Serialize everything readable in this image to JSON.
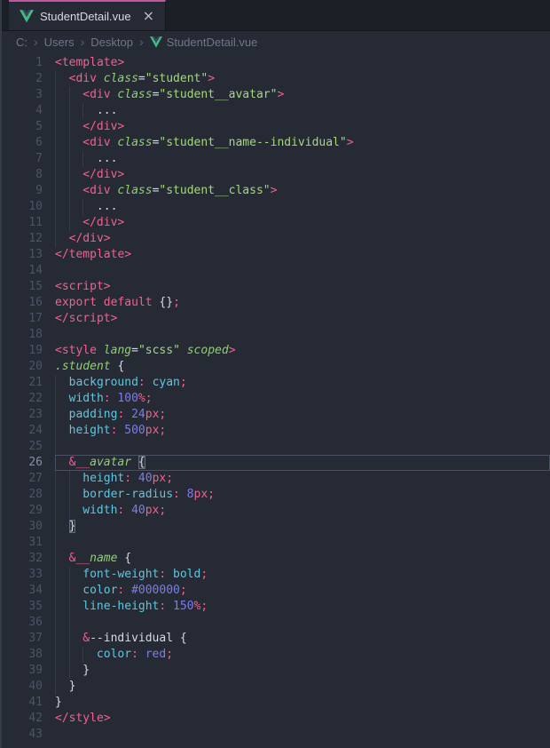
{
  "theme": {
    "bg": "#262a34",
    "tab_bar": "#1b2027",
    "accent": "#c0589e",
    "pink": "#f1618f",
    "green": "#8ed16e",
    "string": "#a3d97c",
    "cyan": "#5cc8e2",
    "violet": "#7d7ce8",
    "fg": "#d6dae4",
    "line_number": "#4c5366",
    "line_number_active": "#8590a8",
    "guide": "#353b4a",
    "line_highlight": "#485064",
    "bracket": "#606a80",
    "breadcrumb": "#6d7689",
    "vue_green": "#42b883",
    "vue_dark": "#35495e"
  },
  "tab": {
    "title": "StudentDetail.vue",
    "close_glyph": "×"
  },
  "breadcrumb": {
    "separator": "›",
    "items": [
      "C:",
      "Users",
      "Desktop",
      "StudentDetail.vue"
    ]
  },
  "editor": {
    "current_line": 26,
    "lines": [
      {
        "n": 1,
        "g": 0,
        "t": [
          [
            "p",
            "<template>"
          ]
        ]
      },
      {
        "n": 2,
        "g": 1,
        "t": [
          [
            "p",
            "<div "
          ],
          [
            "g",
            "class"
          ],
          [
            "w",
            "="
          ],
          [
            "s",
            "\"student\""
          ],
          [
            "p",
            ">"
          ]
        ]
      },
      {
        "n": 3,
        "g": 2,
        "t": [
          [
            "p",
            "<div "
          ],
          [
            "g",
            "class"
          ],
          [
            "w",
            "="
          ],
          [
            "s",
            "\"student__avatar\""
          ],
          [
            "p",
            ">"
          ]
        ]
      },
      {
        "n": 4,
        "g": 3,
        "t": [
          [
            "w",
            "..."
          ]
        ]
      },
      {
        "n": 5,
        "g": 2,
        "t": [
          [
            "p",
            "</div>"
          ]
        ]
      },
      {
        "n": 6,
        "g": 2,
        "t": [
          [
            "p",
            "<div "
          ],
          [
            "g",
            "class"
          ],
          [
            "w",
            "="
          ],
          [
            "s",
            "\"student__name--individual\""
          ],
          [
            "p",
            ">"
          ]
        ]
      },
      {
        "n": 7,
        "g": 3,
        "t": [
          [
            "w",
            "..."
          ]
        ]
      },
      {
        "n": 8,
        "g": 2,
        "t": [
          [
            "p",
            "</div>"
          ]
        ]
      },
      {
        "n": 9,
        "g": 2,
        "t": [
          [
            "p",
            "<div "
          ],
          [
            "g",
            "class"
          ],
          [
            "w",
            "="
          ],
          [
            "s",
            "\"student__class\""
          ],
          [
            "p",
            ">"
          ]
        ]
      },
      {
        "n": 10,
        "g": 3,
        "t": [
          [
            "w",
            "..."
          ]
        ]
      },
      {
        "n": 11,
        "g": 2,
        "t": [
          [
            "p",
            "</div>"
          ]
        ]
      },
      {
        "n": 12,
        "g": 1,
        "t": [
          [
            "p",
            "</div>"
          ]
        ]
      },
      {
        "n": 13,
        "g": 0,
        "t": [
          [
            "p",
            "</template>"
          ]
        ]
      },
      {
        "n": 14,
        "g": 0,
        "t": []
      },
      {
        "n": 15,
        "g": 0,
        "t": [
          [
            "p",
            "<script>"
          ]
        ]
      },
      {
        "n": 16,
        "g": 0,
        "t": [
          [
            "p",
            "export default "
          ],
          [
            "w",
            "{}"
          ],
          [
            "p",
            ";"
          ]
        ]
      },
      {
        "n": 17,
        "g": 0,
        "t": [
          [
            "p",
            "</script>"
          ]
        ]
      },
      {
        "n": 18,
        "g": 0,
        "t": []
      },
      {
        "n": 19,
        "g": 0,
        "t": [
          [
            "p",
            "<style "
          ],
          [
            "g",
            "lang"
          ],
          [
            "w",
            "="
          ],
          [
            "s",
            "\"scss\""
          ],
          [
            "g",
            " scoped"
          ],
          [
            "p",
            ">"
          ]
        ]
      },
      {
        "n": 20,
        "g": 0,
        "t": [
          [
            "g",
            ".student"
          ],
          [
            "w",
            " {"
          ]
        ]
      },
      {
        "n": 21,
        "g": 1,
        "t": [
          [
            "c",
            "background"
          ],
          [
            "p",
            ":"
          ],
          [
            "c",
            " cyan"
          ],
          [
            "p",
            ";"
          ]
        ]
      },
      {
        "n": 22,
        "g": 1,
        "t": [
          [
            "c",
            "width"
          ],
          [
            "p",
            ":"
          ],
          [
            "v",
            " 100"
          ],
          [
            "p",
            "%;"
          ]
        ]
      },
      {
        "n": 23,
        "g": 1,
        "t": [
          [
            "c",
            "padding"
          ],
          [
            "p",
            ":"
          ],
          [
            "v",
            " 24"
          ],
          [
            "p",
            "px;"
          ]
        ]
      },
      {
        "n": 24,
        "g": 1,
        "t": [
          [
            "c",
            "height"
          ],
          [
            "p",
            ":"
          ],
          [
            "v",
            " 500"
          ],
          [
            "p",
            "px;"
          ]
        ]
      },
      {
        "n": 25,
        "g": 1,
        "t": []
      },
      {
        "n": 26,
        "g": 1,
        "t": [
          [
            "p",
            "&__"
          ],
          [
            "g",
            "avatar"
          ],
          [
            "w",
            " "
          ],
          [
            "b",
            "{"
          ]
        ]
      },
      {
        "n": 27,
        "g": 2,
        "t": [
          [
            "c",
            "height"
          ],
          [
            "p",
            ":"
          ],
          [
            "v",
            " 40"
          ],
          [
            "p",
            "px;"
          ]
        ]
      },
      {
        "n": 28,
        "g": 2,
        "t": [
          [
            "c",
            "border-radius"
          ],
          [
            "p",
            ":"
          ],
          [
            "v",
            " 8"
          ],
          [
            "p",
            "px;"
          ]
        ]
      },
      {
        "n": 29,
        "g": 2,
        "t": [
          [
            "c",
            "width"
          ],
          [
            "p",
            ":"
          ],
          [
            "v",
            " 40"
          ],
          [
            "p",
            "px;"
          ]
        ]
      },
      {
        "n": 30,
        "g": 1,
        "t": [
          [
            "b",
            "}"
          ]
        ]
      },
      {
        "n": 31,
        "g": 1,
        "t": []
      },
      {
        "n": 32,
        "g": 1,
        "t": [
          [
            "p",
            "&__"
          ],
          [
            "g",
            "name"
          ],
          [
            "w",
            " {"
          ]
        ]
      },
      {
        "n": 33,
        "g": 2,
        "t": [
          [
            "c",
            "font-weight"
          ],
          [
            "p",
            ":"
          ],
          [
            "c",
            " bold"
          ],
          [
            "p",
            ";"
          ]
        ]
      },
      {
        "n": 34,
        "g": 2,
        "t": [
          [
            "c",
            "color"
          ],
          [
            "p",
            ":"
          ],
          [
            "v",
            " #000000"
          ],
          [
            "p",
            ";"
          ]
        ]
      },
      {
        "n": 35,
        "g": 2,
        "t": [
          [
            "c",
            "line-height"
          ],
          [
            "p",
            ":"
          ],
          [
            "v",
            " 150"
          ],
          [
            "p",
            "%;"
          ]
        ]
      },
      {
        "n": 36,
        "g": 2,
        "t": []
      },
      {
        "n": 37,
        "g": 2,
        "t": [
          [
            "p",
            "&"
          ],
          [
            "w",
            "--individual {"
          ]
        ]
      },
      {
        "n": 38,
        "g": 3,
        "t": [
          [
            "c",
            "color"
          ],
          [
            "p",
            ":"
          ],
          [
            "v",
            " red"
          ],
          [
            "p",
            ";"
          ]
        ]
      },
      {
        "n": 39,
        "g": 2,
        "t": [
          [
            "w",
            "}"
          ]
        ]
      },
      {
        "n": 40,
        "g": 1,
        "t": [
          [
            "w",
            "}"
          ]
        ]
      },
      {
        "n": 41,
        "g": 0,
        "t": [
          [
            "w",
            "}"
          ]
        ]
      },
      {
        "n": 42,
        "g": 0,
        "t": [
          [
            "p",
            "</style>"
          ]
        ]
      },
      {
        "n": 43,
        "g": 0,
        "t": []
      }
    ]
  }
}
